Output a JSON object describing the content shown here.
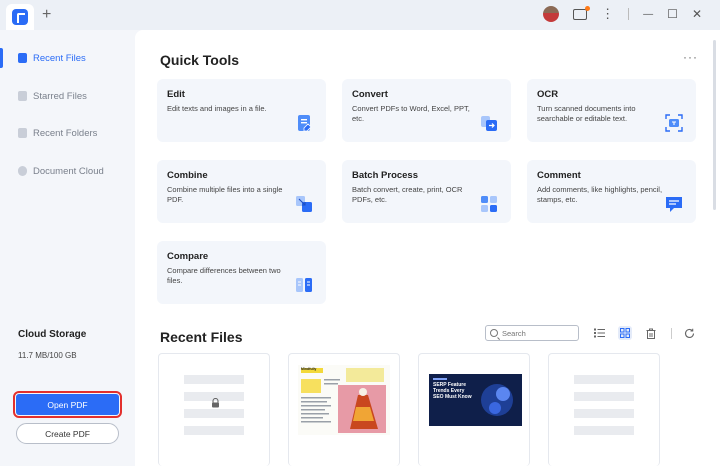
{
  "titlebar": {
    "new_tab_label": "+",
    "menu_dots": "⋮",
    "minimize": "—",
    "maximize": "☐",
    "close": "✕"
  },
  "sidebar": {
    "items": [
      {
        "label": "Recent Files",
        "icon": "recent-files-icon",
        "active": true
      },
      {
        "label": "Starred Files",
        "icon": "star-icon",
        "active": false
      },
      {
        "label": "Recent Folders",
        "icon": "folder-icon",
        "active": false
      },
      {
        "label": "Document Cloud",
        "icon": "cloud-icon",
        "active": false
      }
    ],
    "cloud_storage_title": "Cloud Storage",
    "cloud_storage_usage": "11.7 MB/100 GB",
    "open_pdf_label": "Open PDF",
    "create_pdf_label": "Create PDF"
  },
  "quick_tools": {
    "title": "Quick Tools",
    "more": "···",
    "cards": [
      {
        "title": "Edit",
        "desc": "Edit texts and images in a file."
      },
      {
        "title": "Convert",
        "desc": "Convert PDFs to Word, Excel, PPT, etc."
      },
      {
        "title": "OCR",
        "desc": "Turn scanned documents into searchable or editable text."
      },
      {
        "title": "Combine",
        "desc": "Combine multiple files into a single PDF."
      },
      {
        "title": "Batch Process",
        "desc": "Batch convert, create, print, OCR PDFs, etc."
      },
      {
        "title": "Comment",
        "desc": "Add comments, like highlights, pencil, stamps, etc."
      },
      {
        "title": "Compare",
        "desc": "Compare differences between two files."
      }
    ]
  },
  "recent_files": {
    "title": "Recent Files",
    "search_placeholder": "Search",
    "thumb2_label": "Mindfully",
    "thumb3_text": "SERP Feature Trends Every SEO Must Know"
  },
  "colors": {
    "accent": "#2b6cf6",
    "highlight_outline": "#e3302d"
  }
}
